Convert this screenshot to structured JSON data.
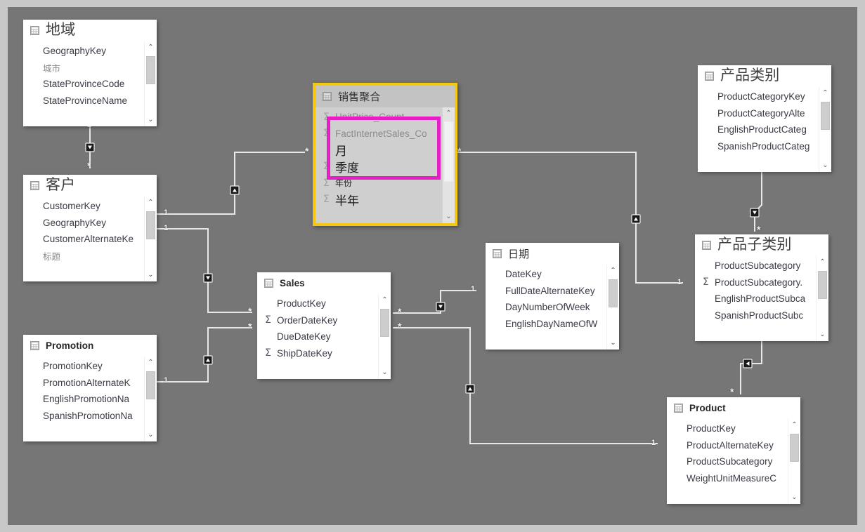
{
  "canvas": {
    "background_color": "#767676",
    "outer_border_color": "#c8c8c8",
    "highlight_border_color": "#f2c811",
    "selection_box_color": "#e61ec3"
  },
  "tables": [
    {
      "id": "geography",
      "name": "地域",
      "title_style": "cjk-large",
      "icon": "table-grid-icon",
      "fields": [
        {
          "label": "GeographyKey",
          "measure": false,
          "dimmed": false
        },
        {
          "label": "城市",
          "measure": false,
          "dimmed": true
        },
        {
          "label": "StateProvinceCode",
          "measure": false,
          "dimmed": false
        },
        {
          "label": "StateProvinceName",
          "measure": false,
          "dimmed": false
        }
      ]
    },
    {
      "id": "customer",
      "name": "客户",
      "title_style": "cjk-large",
      "icon": "table-grid-icon",
      "fields": [
        {
          "label": "CustomerKey",
          "measure": false,
          "dimmed": false
        },
        {
          "label": "GeographyKey",
          "measure": false,
          "dimmed": false
        },
        {
          "label": "CustomerAlternateKe",
          "measure": false,
          "dimmed": false
        },
        {
          "label": "标题",
          "measure": false,
          "dimmed": true
        }
      ]
    },
    {
      "id": "promotion",
      "name": "Promotion",
      "title_style": "latin",
      "icon": "table-grid-icon",
      "fields": [
        {
          "label": "PromotionKey",
          "measure": false,
          "dimmed": false
        },
        {
          "label": "PromotionAlternateK",
          "measure": false,
          "dimmed": false
        },
        {
          "label": "EnglishPromotionNa",
          "measure": false,
          "dimmed": false
        },
        {
          "label": "SpanishPromotionNa",
          "measure": false,
          "dimmed": false
        }
      ]
    },
    {
      "id": "sales",
      "name": "Sales",
      "title_style": "latin",
      "icon": "table-grid-icon",
      "fields": [
        {
          "label": "ProductKey",
          "measure": false,
          "dimmed": false
        },
        {
          "label": "OrderDateKey",
          "measure": true,
          "dimmed": false
        },
        {
          "label": "DueDateKey",
          "measure": false,
          "dimmed": false
        },
        {
          "label": "ShipDateKey",
          "measure": true,
          "dimmed": false
        }
      ]
    },
    {
      "id": "date",
      "name": "日期",
      "title_style": "cjk-small",
      "icon": "table-grid-icon",
      "fields": [
        {
          "label": "DateKey",
          "measure": false,
          "dimmed": false
        },
        {
          "label": "FullDateAlternateKey",
          "measure": false,
          "dimmed": false
        },
        {
          "label": "DayNumberOfWeek",
          "measure": false,
          "dimmed": false
        },
        {
          "label": "EnglishDayNameOfW",
          "measure": false,
          "dimmed": false
        }
      ]
    },
    {
      "id": "product-category",
      "name": "产品类别",
      "title_style": "cjk-large",
      "icon": "table-grid-icon",
      "fields": [
        {
          "label": "ProductCategoryKey",
          "measure": false,
          "dimmed": false
        },
        {
          "label": "ProductCategoryAlte",
          "measure": false,
          "dimmed": false
        },
        {
          "label": "EnglishProductCateg",
          "measure": false,
          "dimmed": false
        },
        {
          "label": "SpanishProductCateg",
          "measure": false,
          "dimmed": false
        }
      ]
    },
    {
      "id": "product-subcategory",
      "name": "产品子类别",
      "title_style": "cjk-large",
      "icon": "table-grid-icon",
      "fields": [
        {
          "label": "ProductSubcategory",
          "measure": false,
          "dimmed": false
        },
        {
          "label": "ProductSubcategory.",
          "measure": true,
          "dimmed": false
        },
        {
          "label": "EnglishProductSubca",
          "measure": false,
          "dimmed": false
        },
        {
          "label": "SpanishProductSubc",
          "measure": false,
          "dimmed": false
        }
      ]
    },
    {
      "id": "product",
      "name": "Product",
      "title_style": "latin",
      "icon": "table-grid-icon",
      "fields": [
        {
          "label": "ProductKey",
          "measure": false,
          "dimmed": false
        },
        {
          "label": "ProductAlternateKey",
          "measure": false,
          "dimmed": false
        },
        {
          "label": "ProductSubcategory",
          "measure": false,
          "dimmed": false
        },
        {
          "label": "WeightUnitMeasureC",
          "measure": false,
          "dimmed": false
        }
      ]
    }
  ],
  "aggregation_table": {
    "id": "sales-aggregation",
    "name": "销售聚合",
    "icon": "table-grid-icon",
    "selected": true,
    "fields": [
      {
        "label": "UnitPrice_Count",
        "measure": true,
        "highlighted": false
      },
      {
        "label": "FactInternetSales_Co",
        "measure": true,
        "highlighted": false
      },
      {
        "label": "月",
        "measure": false,
        "highlighted": true,
        "size": "big"
      },
      {
        "label": "季度",
        "measure": true,
        "highlighted": true,
        "size": "big"
      },
      {
        "label": "年份",
        "measure": true,
        "highlighted": true,
        "size": "small"
      },
      {
        "label": "半年",
        "measure": true,
        "highlighted": true,
        "size": "big"
      }
    ]
  },
  "relationships": [
    {
      "id": "geography-customer",
      "from": "地域",
      "to": "客户",
      "from_cardinality": "1",
      "to_cardinality": "*"
    },
    {
      "id": "customer-sales-agg",
      "from": "客户",
      "to": "销售聚合",
      "from_cardinality": "1",
      "to_cardinality": "*"
    },
    {
      "id": "customer-sales",
      "from": "客户",
      "to": "Sales",
      "from_cardinality": "1",
      "to_cardinality": "*"
    },
    {
      "id": "promotion-sales",
      "from": "Promotion",
      "to": "Sales",
      "from_cardinality": "1",
      "to_cardinality": "*"
    },
    {
      "id": "sales-date",
      "from": "Sales",
      "to": "日期",
      "from_cardinality": "*",
      "to_cardinality": "1"
    },
    {
      "id": "sales-product",
      "from": "Sales",
      "to": "Product",
      "from_cardinality": "*",
      "to_cardinality": "1"
    },
    {
      "id": "sales-agg-subcategory",
      "from": "销售聚合",
      "to": "产品子类别",
      "from_cardinality": "*",
      "to_cardinality": "1"
    },
    {
      "id": "category-subcategory",
      "from": "产品类别",
      "to": "产品子类别",
      "from_cardinality": "1",
      "to_cardinality": "*"
    },
    {
      "id": "subcategory-product",
      "from": "产品子类别",
      "to": "Product",
      "from_cardinality": "1",
      "to_cardinality": "*"
    }
  ],
  "cardinality_labels": {
    "one": "1",
    "many": "*"
  },
  "scroll_glyphs": {
    "up": "⌃",
    "down": "⌄"
  },
  "measure_glyph": "Σ"
}
